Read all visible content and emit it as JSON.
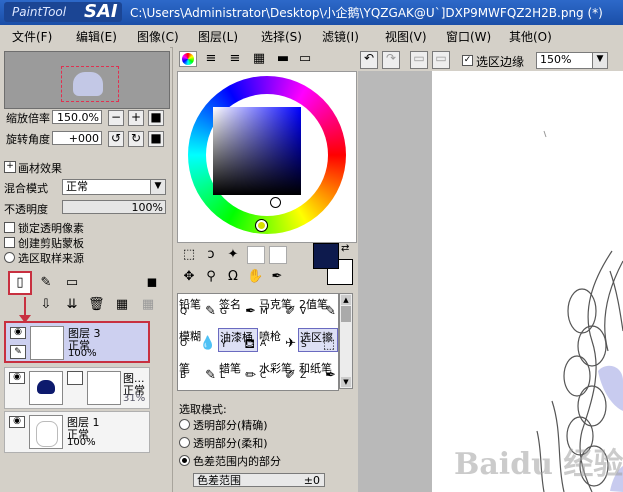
{
  "titlebar": {
    "brand": "PaintTool",
    "brand_sai": "SAI",
    "title": "C:\\Users\\Administrator\\Desktop\\小企鹅\\YQZGAK@U`]DXP9MWFQZ2H2B.png (*)"
  },
  "menu": {
    "items": [
      "文件(F)",
      "编辑(E)",
      "图像(C)",
      "图层(L)",
      "选择(S)",
      "滤镜(I)",
      "视图(V)",
      "窗口(W)",
      "其他(O)"
    ]
  },
  "navigator": {
    "zoom_label": "缩放倍率",
    "zoom_value": "150.0%",
    "rotate_label": "旋转角度",
    "rotate_value": "+000"
  },
  "layer_props": {
    "effect_label": "画材效果",
    "blend_label": "混合模式",
    "blend_value": "正常",
    "opacity_label": "不透明度",
    "opacity_value": "100%",
    "lock_label": "锁定透明像素",
    "clip_label": "创建剪贴蒙板",
    "source_label": "选区取样来源"
  },
  "layers": [
    {
      "name": "图层 3",
      "mode": "正常",
      "opacity": "100%"
    },
    {
      "name": "图...",
      "mode": "正常",
      "opacity": "31%"
    },
    {
      "name": "图层 1",
      "mode": "正常",
      "opacity": "100%"
    }
  ],
  "colors": {
    "foreground": "#0d1a4d",
    "accent_selection": "#c83040",
    "titlebar": "#2d69c9"
  },
  "brushes": [
    {
      "name": "铅笔",
      "key": "Q"
    },
    {
      "name": "签名",
      "key": "G"
    },
    {
      "name": "马克笔",
      "key": "M"
    },
    {
      "name": "2值笔",
      "key": "V"
    },
    {
      "name": "模糊",
      "key": "O"
    },
    {
      "name": "油漆桶",
      "key": "Y"
    },
    {
      "name": "喷枪",
      "key": "A"
    },
    {
      "name": "选区擦",
      "key": "S"
    },
    {
      "name": "笔",
      "key": "B"
    },
    {
      "name": "蜡笔",
      "key": "L"
    },
    {
      "name": "水彩笔",
      "key": "C"
    },
    {
      "name": "和纸笔",
      "key": "Z"
    }
  ],
  "selection": {
    "title": "选取模式:",
    "opt1": "透明部分(精确)",
    "opt2": "透明部分(柔和)",
    "opt3": "色差范围内的部分",
    "range_label": "色差范围",
    "range_value": "±0"
  },
  "canvas_toolbar": {
    "edge_label": "选区边缘",
    "zoom": "150%"
  },
  "watermark": "Baidu 经验"
}
